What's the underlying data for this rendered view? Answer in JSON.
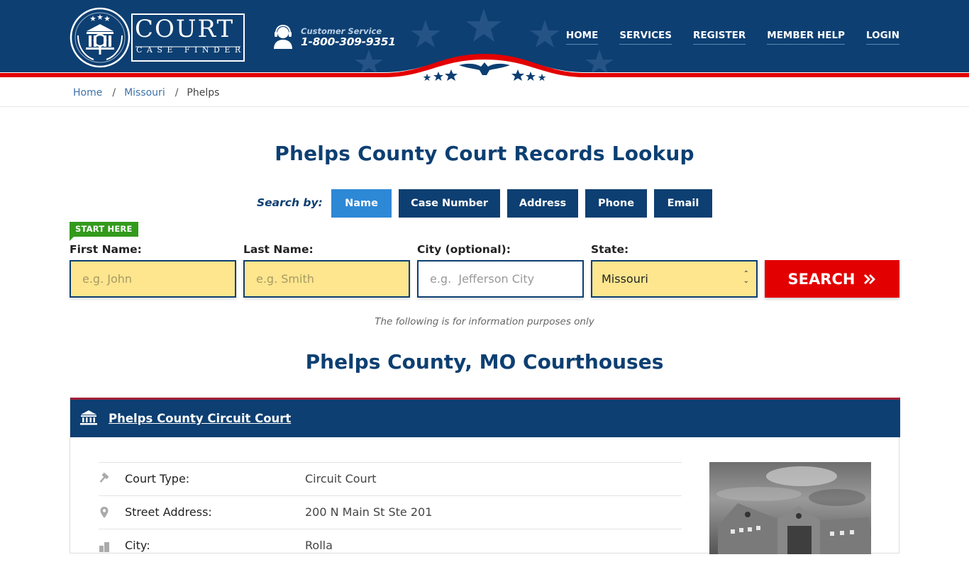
{
  "header": {
    "logo_word": "COURT",
    "logo_sub": "CASE FINDER",
    "customer_service_label": "Customer Service",
    "customer_service_phone": "1-800-309-9351",
    "nav": [
      "HOME",
      "SERVICES",
      "REGISTER",
      "MEMBER HELP",
      "LOGIN"
    ],
    "colors": {
      "navy": "#0d3f72",
      "red": "#e30000"
    }
  },
  "breadcrumb": {
    "items": [
      "Home",
      "Missouri"
    ],
    "current": "Phelps",
    "separator": "/"
  },
  "page_title": "Phelps County Court Records Lookup",
  "search": {
    "search_by_label": "Search by:",
    "tabs": [
      "Name",
      "Case Number",
      "Address",
      "Phone",
      "Email"
    ],
    "active_tab": "Name",
    "start_here": "START HERE",
    "fields": {
      "first_name": {
        "label": "First Name:",
        "placeholder": "e.g. John",
        "value": ""
      },
      "last_name": {
        "label": "Last Name:",
        "placeholder": "e.g. Smith",
        "value": ""
      },
      "city": {
        "label": "City (optional):",
        "placeholder": "e.g.  Jefferson City",
        "value": ""
      },
      "state": {
        "label": "State:",
        "value": "Missouri"
      }
    },
    "search_button": "SEARCH",
    "search_button_icon": "double-chevron-right",
    "info_note": "The following is for information purposes only"
  },
  "courthouses": {
    "title": "Phelps County, MO Courthouses",
    "items": [
      {
        "name": "Phelps County Circuit Court",
        "icon": "courthouse-icon",
        "rows": [
          {
            "icon": "gavel-icon",
            "label": "Court Type:",
            "value": "Circuit Court"
          },
          {
            "icon": "map-pin-icon",
            "label": "Street Address:",
            "value": "200 N Main St Ste 201"
          },
          {
            "icon": "city-icon",
            "label": "City:",
            "value": "Rolla"
          }
        ],
        "photo_alt": "Courthouse photo"
      }
    ]
  }
}
